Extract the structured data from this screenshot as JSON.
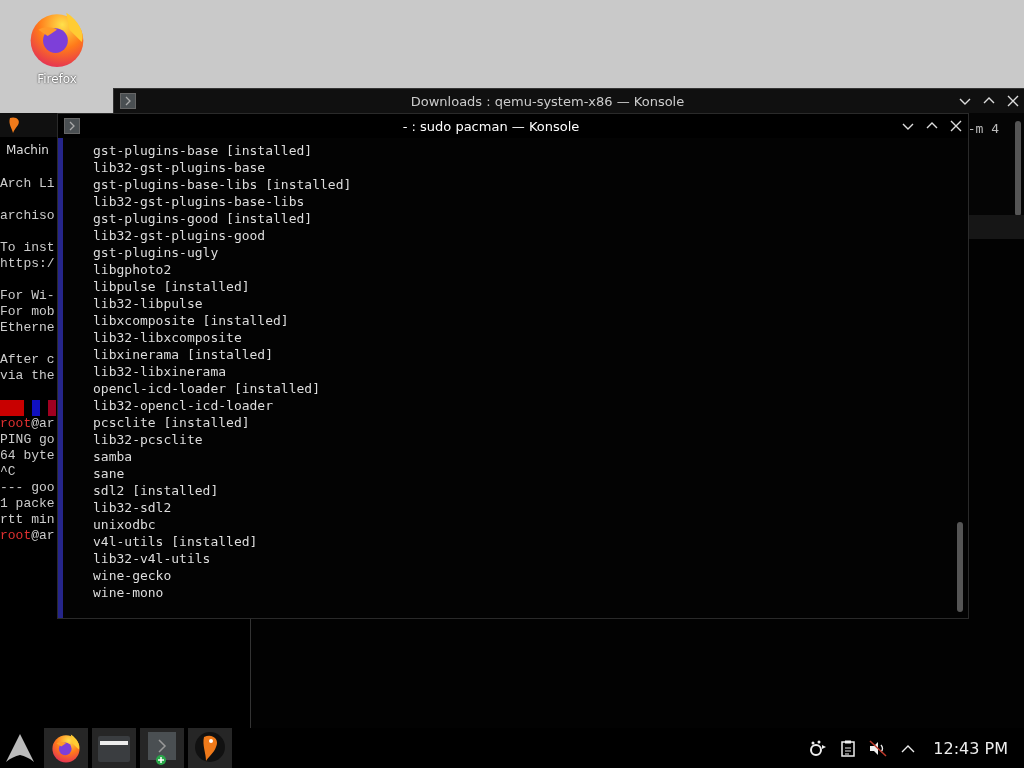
{
  "desktop": {
    "icons": [
      {
        "label": "Firefox",
        "kind": "firefox"
      }
    ]
  },
  "qemu_window": {
    "menu": [
      "Machin"
    ],
    "lines": [
      {
        "kind": "text",
        "text": "Arch Li"
      },
      {
        "kind": "blank"
      },
      {
        "kind": "text",
        "text": "archiso"
      },
      {
        "kind": "blank"
      },
      {
        "kind": "text",
        "text": "To inst"
      },
      {
        "kind": "text",
        "text": "https:/"
      },
      {
        "kind": "blank"
      },
      {
        "kind": "text",
        "text": "For Wi-"
      },
      {
        "kind": "text",
        "text": "For mob"
      },
      {
        "kind": "text",
        "text": "Etherne"
      },
      {
        "kind": "blank"
      },
      {
        "kind": "text",
        "text": "After c"
      },
      {
        "kind": "text",
        "text": "via the"
      },
      {
        "kind": "blank"
      },
      {
        "kind": "swatches"
      },
      {
        "kind": "prompt",
        "user": "root",
        "rest": "@ar"
      },
      {
        "kind": "text",
        "text": "PING go"
      },
      {
        "kind": "text",
        "text": "64 byte"
      },
      {
        "kind": "text",
        "text": "^C"
      },
      {
        "kind": "text",
        "text": "--- goo"
      },
      {
        "kind": "text",
        "text": "1 packe"
      },
      {
        "kind": "text",
        "text": "rtt min"
      },
      {
        "kind": "prompt",
        "user": "root",
        "rest": "@ar"
      }
    ]
  },
  "downloads_window": {
    "title": "Downloads : qemu-system-x86 — Konsole",
    "lines": [
      "-m 4"
    ]
  },
  "pacman_window": {
    "title": "- : sudo pacman — Konsole",
    "active": true,
    "lines": [
      "gst-plugins-base [installed]",
      "lib32-gst-plugins-base",
      "gst-plugins-base-libs [installed]",
      "lib32-gst-plugins-base-libs",
      "gst-plugins-good [installed]",
      "lib32-gst-plugins-good",
      "gst-plugins-ugly",
      "libgphoto2",
      "libpulse [installed]",
      "lib32-libpulse",
      "libxcomposite [installed]",
      "lib32-libxcomposite",
      "libxinerama [installed]",
      "lib32-libxinerama",
      "opencl-icd-loader [installed]",
      "lib32-opencl-icd-loader",
      "pcsclite [installed]",
      "lib32-pcsclite",
      "samba",
      "sane",
      "sdl2 [installed]",
      "lib32-sdl2",
      "unixodbc",
      "v4l-utils [installed]",
      "lib32-v4l-utils",
      "wine-gecko",
      "wine-mono"
    ]
  },
  "taskbar": {
    "launcher": {
      "kind": "arch"
    },
    "tasks": [
      {
        "kind": "firefox"
      },
      {
        "kind": "files"
      },
      {
        "kind": "terminal"
      },
      {
        "kind": "qemu"
      }
    ],
    "tray": [
      {
        "kind": "network"
      },
      {
        "kind": "clipboard"
      },
      {
        "kind": "volume",
        "muted": true
      },
      {
        "kind": "expand"
      }
    ],
    "clock": "12:43 PM"
  }
}
